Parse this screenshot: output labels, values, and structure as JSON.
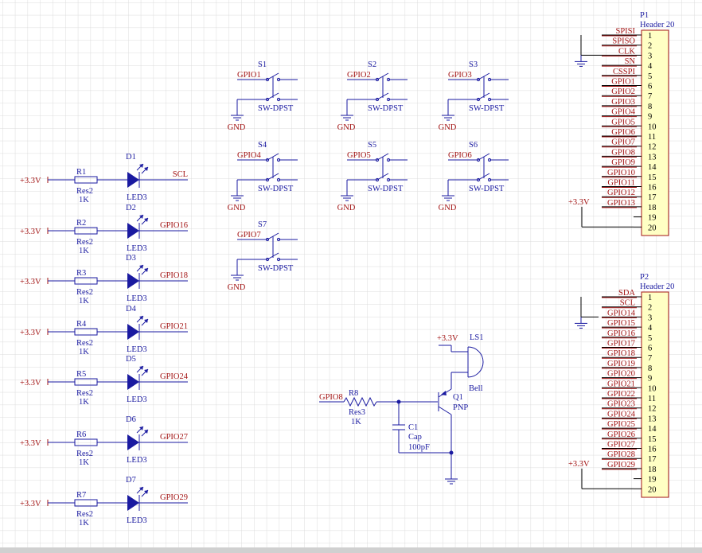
{
  "colors": {
    "grid": "#d8d8d8",
    "wire": "#1a1aa0",
    "label": "#a31515",
    "header_fill": "#ffffc4",
    "header_border": "#a31515"
  },
  "net": {
    "vcc": "+3.3V",
    "gnd": "GND"
  },
  "leds": [
    {
      "led": "D1",
      "res": "R1",
      "res_type": "Res2",
      "res_val": "1K",
      "led_type": "LED3",
      "net": "SCL"
    },
    {
      "led": "D2",
      "res": "R2",
      "res_type": "Res2",
      "res_val": "1K",
      "led_type": "LED3",
      "net": "GPIO16"
    },
    {
      "led": "D3",
      "res": "R3",
      "res_type": "Res2",
      "res_val": "1K",
      "led_type": "LED3",
      "net": "GPIO18"
    },
    {
      "led": "D4",
      "res": "R4",
      "res_type": "Res2",
      "res_val": "1K",
      "led_type": "LED3",
      "net": "GPIO21"
    },
    {
      "led": "D5",
      "res": "R5",
      "res_type": "Res2",
      "res_val": "1K",
      "led_type": "LED3",
      "net": "GPIO24"
    },
    {
      "led": "D6",
      "res": "R6",
      "res_type": "Res2",
      "res_val": "1K",
      "led_type": "LED3",
      "net": "GPIO27"
    },
    {
      "led": "D7",
      "res": "R7",
      "res_type": "Res2",
      "res_val": "1K",
      "led_type": "LED3",
      "net": "GPIO29"
    }
  ],
  "switches": [
    {
      "ref": "S1",
      "net": "GPIO1",
      "type": "SW-DPST"
    },
    {
      "ref": "S2",
      "net": "GPIO2",
      "type": "SW-DPST"
    },
    {
      "ref": "S3",
      "net": "GPIO3",
      "type": "SW-DPST"
    },
    {
      "ref": "S4",
      "net": "GPIO4",
      "type": "SW-DPST"
    },
    {
      "ref": "S5",
      "net": "GPIO5",
      "type": "SW-DPST"
    },
    {
      "ref": "S6",
      "net": "GPIO6",
      "type": "SW-DPST"
    },
    {
      "ref": "S7",
      "net": "GPIO7",
      "type": "SW-DPST"
    }
  ],
  "buzzer": {
    "in_net": "GPIO8",
    "r_ref": "R8",
    "r_type": "Res3",
    "r_val": "1K",
    "c_ref": "C1",
    "c_type": "Cap",
    "c_val": "100pF",
    "q_ref": "Q1",
    "q_type": "PNP",
    "ls_ref": "LS1",
    "ls_type": "Bell",
    "vcc": "+3.3V"
  },
  "headers": [
    {
      "ref": "P1",
      "type": "Header 20",
      "pins": [
        "1",
        "2",
        "3",
        "4",
        "5",
        "6",
        "7",
        "8",
        "9",
        "10",
        "11",
        "12",
        "13",
        "14",
        "15",
        "16",
        "17",
        "18",
        "19",
        "20"
      ],
      "labels": [
        "SPISI",
        "SPISO",
        "CLK",
        "SN",
        "CSSPI",
        "GPIO1",
        "GPIO2",
        "GPIO3",
        "GPIO4",
        "GPIO5",
        "GPIO6",
        "GPIO7",
        "GPIO8",
        "GPIO9",
        "GPIO10",
        "GPIO11",
        "GPIO12",
        "GPIO13",
        "",
        ""
      ],
      "vcc": "+3.3V"
    },
    {
      "ref": "P2",
      "type": "Header 20",
      "pins": [
        "1",
        "2",
        "3",
        "4",
        "5",
        "6",
        "7",
        "8",
        "9",
        "10",
        "11",
        "12",
        "13",
        "14",
        "15",
        "16",
        "17",
        "18",
        "19",
        "20"
      ],
      "labels": [
        "SDA",
        "SCL",
        "GPIO14",
        "GPIO15",
        "GPIO16",
        "GPIO17",
        "GPIO18",
        "GPIO19",
        "GPIO20",
        "GPIO21",
        "GPIO22",
        "GPIO23",
        "GPIO24",
        "GPIO25",
        "GPIO26",
        "GPIO27",
        "GPIO28",
        "GPIO29",
        "",
        ""
      ],
      "vcc": "+3.3V"
    }
  ]
}
